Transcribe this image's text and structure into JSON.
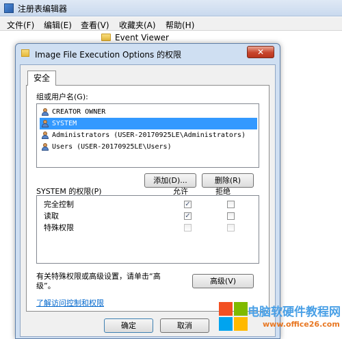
{
  "app": {
    "title": "注册表编辑器",
    "menu": [
      "文件(F)",
      "编辑(E)",
      "查看(V)",
      "收藏夹(A)",
      "帮助(H)"
    ],
    "tree_item": "Event Viewer"
  },
  "dialog": {
    "title": "Image File Execution Options 的权限",
    "close_glyph": "✕",
    "tab": "安全",
    "group_label": "组或用户名(G):",
    "users": [
      "CREATOR OWNER",
      "SYSTEM",
      "Administrators (USER-20170925LE\\Administrators)",
      "Users (USER-20170925LE\\Users)"
    ],
    "selected_user_index": 1,
    "add_button": "添加(D)...",
    "remove_button": "删除(R)",
    "perm_label": "SYSTEM 的权限(P)",
    "allow_header": "允许",
    "deny_header": "拒绝",
    "permissions": [
      {
        "name": "完全控制",
        "allow": true,
        "deny": false,
        "allow_disabled": false,
        "deny_disabled": false
      },
      {
        "name": "读取",
        "allow": true,
        "deny": false,
        "allow_disabled": false,
        "deny_disabled": false
      },
      {
        "name": "特殊权限",
        "allow": false,
        "deny": false,
        "allow_disabled": true,
        "deny_disabled": true
      }
    ],
    "advanced_text_line1": "有关特殊权限或高级设置，请单击“高",
    "advanced_text_line2": "级”。",
    "advanced_button": "高级(V)",
    "help_link": "了解访问控制和权限",
    "ok_button": "确定",
    "cancel_button": "取消"
  },
  "watermark": {
    "line1": "电脑软硬件教程网",
    "line2": "www.office26.com"
  }
}
